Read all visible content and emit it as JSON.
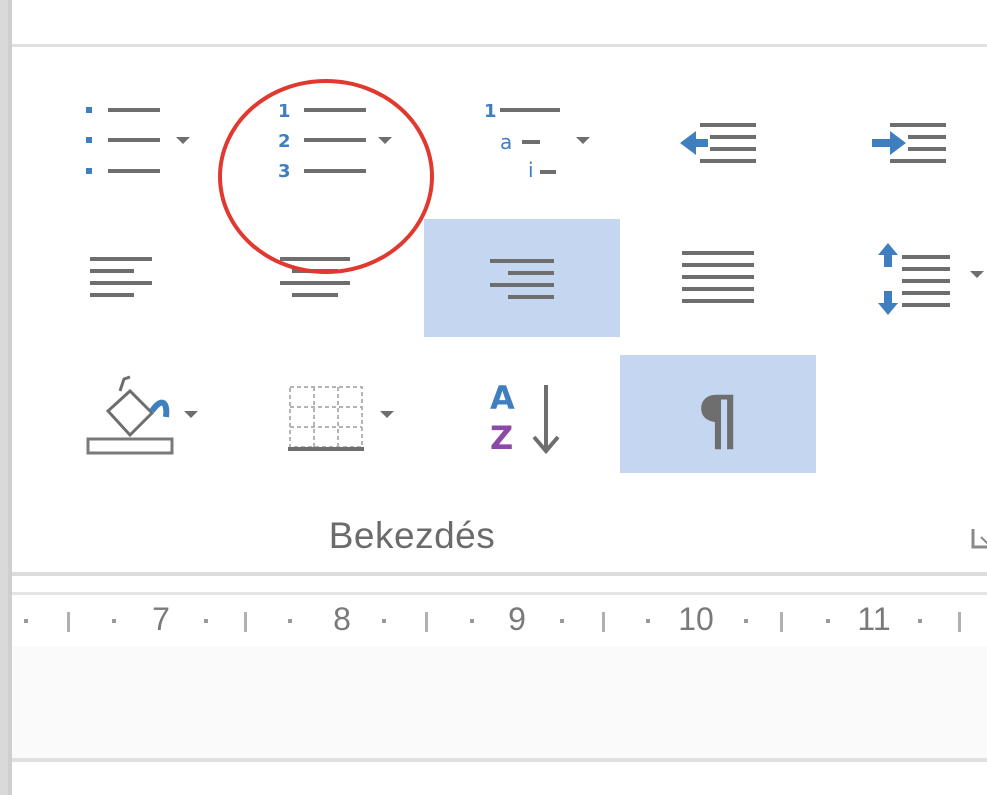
{
  "ribbon": {
    "group_label": "Bekezdés",
    "row1": [
      {
        "name": "bullets-button",
        "icon": "bullet-list-icon",
        "dropdown": true
      },
      {
        "name": "numbering-button",
        "icon": "numbered-list-icon",
        "dropdown": true,
        "highlighted": true
      },
      {
        "name": "multilevel-list-button",
        "icon": "multilevel-list-icon",
        "dropdown": true
      },
      {
        "name": "decrease-indent-button",
        "icon": "decrease-indent-icon"
      },
      {
        "name": "increase-indent-button",
        "icon": "increase-indent-icon"
      }
    ],
    "row2": [
      {
        "name": "align-left-button",
        "icon": "align-left-icon"
      },
      {
        "name": "align-center-button",
        "icon": "align-center-icon"
      },
      {
        "name": "align-right-button",
        "icon": "align-right-icon",
        "active": true
      },
      {
        "name": "justify-button",
        "icon": "justify-icon"
      },
      {
        "name": "line-spacing-button",
        "icon": "line-spacing-icon",
        "dropdown": true
      }
    ],
    "row3": [
      {
        "name": "shading-button",
        "icon": "paint-bucket-icon",
        "dropdown": true
      },
      {
        "name": "borders-button",
        "icon": "borders-icon",
        "dropdown": true
      },
      {
        "name": "sort-button",
        "icon": "sort-az-icon"
      },
      {
        "name": "show-formatting-button",
        "icon": "pilcrow-icon",
        "active": true
      }
    ],
    "numbered_list_glyphs": [
      "1",
      "2",
      "3"
    ],
    "multilevel_glyphs": [
      "1",
      "a",
      "i"
    ],
    "sort_glyphs": [
      "A",
      "Z"
    ],
    "pilcrow": "¶"
  },
  "ruler": {
    "labels": [
      "7",
      "8",
      "9",
      "10",
      "11"
    ]
  },
  "colors": {
    "active_background": "#c5d7f0",
    "icon_blue": "#3f7fc0",
    "icon_gray": "#6e6e6e",
    "annotation_red": "#e0392f",
    "sort_purple": "#8c4aa8"
  }
}
